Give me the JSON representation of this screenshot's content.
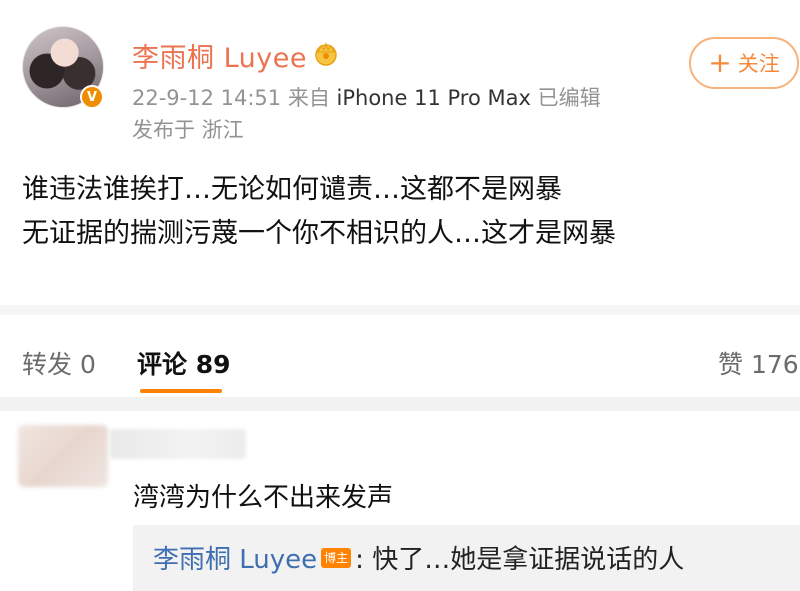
{
  "post": {
    "username": "李雨桐 Luyee",
    "meta_time": "22-9-12 14:51",
    "meta_from_label": "来自",
    "meta_device": "iPhone 11 Pro Max",
    "meta_edited": "已编辑",
    "location": "发布于 浙江",
    "follow_label": "关注",
    "content_lines": [
      "谁违法谁挨打…无论如何谴责…这都不是网暴",
      "无证据的揣测污蔑一个你不相识的人…这才是网暴"
    ]
  },
  "tabs": {
    "repost": "转发 0",
    "comment": "评论 89",
    "like": "赞 176"
  },
  "comment": {
    "text": "湾湾为什么不出来发声",
    "reply": {
      "name": "李雨桐 Luyee",
      "badge": "博主",
      "text": ": 快了…她是拿证据说话的人"
    }
  },
  "colors": {
    "accent": "#ff8200",
    "username": "#eb7350",
    "reply_name": "#3f6fb0"
  }
}
